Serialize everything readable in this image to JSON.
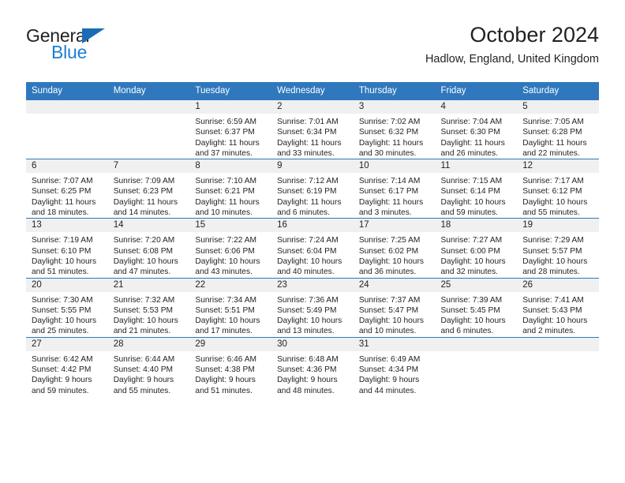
{
  "brand": {
    "name_part1": "General",
    "name_part2": "Blue",
    "accent_color": "#1b7fd4",
    "triangle_color": "#1b6cb5"
  },
  "header": {
    "title": "October 2024",
    "location": "Hadlow, England, United Kingdom",
    "header_bg_color": "#2f78bd",
    "header_text_color": "#ffffff"
  },
  "weekdays": [
    "Sunday",
    "Monday",
    "Tuesday",
    "Wednesday",
    "Thursday",
    "Friday",
    "Saturday"
  ],
  "labels": {
    "sunrise_prefix": "Sunrise:",
    "sunset_prefix": "Sunset:",
    "daylight_prefix": "Daylight:"
  },
  "weeks": [
    [
      {
        "day": "",
        "blank": true
      },
      {
        "day": "",
        "blank": true
      },
      {
        "day": "1",
        "sunrise": "Sunrise: 6:59 AM",
        "sunset": "Sunset: 6:37 PM",
        "daylight_line1": "Daylight: 11 hours",
        "daylight_line2": "and 37 minutes."
      },
      {
        "day": "2",
        "sunrise": "Sunrise: 7:01 AM",
        "sunset": "Sunset: 6:34 PM",
        "daylight_line1": "Daylight: 11 hours",
        "daylight_line2": "and 33 minutes."
      },
      {
        "day": "3",
        "sunrise": "Sunrise: 7:02 AM",
        "sunset": "Sunset: 6:32 PM",
        "daylight_line1": "Daylight: 11 hours",
        "daylight_line2": "and 30 minutes."
      },
      {
        "day": "4",
        "sunrise": "Sunrise: 7:04 AM",
        "sunset": "Sunset: 6:30 PM",
        "daylight_line1": "Daylight: 11 hours",
        "daylight_line2": "and 26 minutes."
      },
      {
        "day": "5",
        "sunrise": "Sunrise: 7:05 AM",
        "sunset": "Sunset: 6:28 PM",
        "daylight_line1": "Daylight: 11 hours",
        "daylight_line2": "and 22 minutes."
      }
    ],
    [
      {
        "day": "6",
        "sunrise": "Sunrise: 7:07 AM",
        "sunset": "Sunset: 6:25 PM",
        "daylight_line1": "Daylight: 11 hours",
        "daylight_line2": "and 18 minutes."
      },
      {
        "day": "7",
        "sunrise": "Sunrise: 7:09 AM",
        "sunset": "Sunset: 6:23 PM",
        "daylight_line1": "Daylight: 11 hours",
        "daylight_line2": "and 14 minutes."
      },
      {
        "day": "8",
        "sunrise": "Sunrise: 7:10 AM",
        "sunset": "Sunset: 6:21 PM",
        "daylight_line1": "Daylight: 11 hours",
        "daylight_line2": "and 10 minutes."
      },
      {
        "day": "9",
        "sunrise": "Sunrise: 7:12 AM",
        "sunset": "Sunset: 6:19 PM",
        "daylight_line1": "Daylight: 11 hours",
        "daylight_line2": "and 6 minutes."
      },
      {
        "day": "10",
        "sunrise": "Sunrise: 7:14 AM",
        "sunset": "Sunset: 6:17 PM",
        "daylight_line1": "Daylight: 11 hours",
        "daylight_line2": "and 3 minutes."
      },
      {
        "day": "11",
        "sunrise": "Sunrise: 7:15 AM",
        "sunset": "Sunset: 6:14 PM",
        "daylight_line1": "Daylight: 10 hours",
        "daylight_line2": "and 59 minutes."
      },
      {
        "day": "12",
        "sunrise": "Sunrise: 7:17 AM",
        "sunset": "Sunset: 6:12 PM",
        "daylight_line1": "Daylight: 10 hours",
        "daylight_line2": "and 55 minutes."
      }
    ],
    [
      {
        "day": "13",
        "sunrise": "Sunrise: 7:19 AM",
        "sunset": "Sunset: 6:10 PM",
        "daylight_line1": "Daylight: 10 hours",
        "daylight_line2": "and 51 minutes."
      },
      {
        "day": "14",
        "sunrise": "Sunrise: 7:20 AM",
        "sunset": "Sunset: 6:08 PM",
        "daylight_line1": "Daylight: 10 hours",
        "daylight_line2": "and 47 minutes."
      },
      {
        "day": "15",
        "sunrise": "Sunrise: 7:22 AM",
        "sunset": "Sunset: 6:06 PM",
        "daylight_line1": "Daylight: 10 hours",
        "daylight_line2": "and 43 minutes."
      },
      {
        "day": "16",
        "sunrise": "Sunrise: 7:24 AM",
        "sunset": "Sunset: 6:04 PM",
        "daylight_line1": "Daylight: 10 hours",
        "daylight_line2": "and 40 minutes."
      },
      {
        "day": "17",
        "sunrise": "Sunrise: 7:25 AM",
        "sunset": "Sunset: 6:02 PM",
        "daylight_line1": "Daylight: 10 hours",
        "daylight_line2": "and 36 minutes."
      },
      {
        "day": "18",
        "sunrise": "Sunrise: 7:27 AM",
        "sunset": "Sunset: 6:00 PM",
        "daylight_line1": "Daylight: 10 hours",
        "daylight_line2": "and 32 minutes."
      },
      {
        "day": "19",
        "sunrise": "Sunrise: 7:29 AM",
        "sunset": "Sunset: 5:57 PM",
        "daylight_line1": "Daylight: 10 hours",
        "daylight_line2": "and 28 minutes."
      }
    ],
    [
      {
        "day": "20",
        "sunrise": "Sunrise: 7:30 AM",
        "sunset": "Sunset: 5:55 PM",
        "daylight_line1": "Daylight: 10 hours",
        "daylight_line2": "and 25 minutes."
      },
      {
        "day": "21",
        "sunrise": "Sunrise: 7:32 AM",
        "sunset": "Sunset: 5:53 PM",
        "daylight_line1": "Daylight: 10 hours",
        "daylight_line2": "and 21 minutes."
      },
      {
        "day": "22",
        "sunrise": "Sunrise: 7:34 AM",
        "sunset": "Sunset: 5:51 PM",
        "daylight_line1": "Daylight: 10 hours",
        "daylight_line2": "and 17 minutes."
      },
      {
        "day": "23",
        "sunrise": "Sunrise: 7:36 AM",
        "sunset": "Sunset: 5:49 PM",
        "daylight_line1": "Daylight: 10 hours",
        "daylight_line2": "and 13 minutes."
      },
      {
        "day": "24",
        "sunrise": "Sunrise: 7:37 AM",
        "sunset": "Sunset: 5:47 PM",
        "daylight_line1": "Daylight: 10 hours",
        "daylight_line2": "and 10 minutes."
      },
      {
        "day": "25",
        "sunrise": "Sunrise: 7:39 AM",
        "sunset": "Sunset: 5:45 PM",
        "daylight_line1": "Daylight: 10 hours",
        "daylight_line2": "and 6 minutes."
      },
      {
        "day": "26",
        "sunrise": "Sunrise: 7:41 AM",
        "sunset": "Sunset: 5:43 PM",
        "daylight_line1": "Daylight: 10 hours",
        "daylight_line2": "and 2 minutes."
      }
    ],
    [
      {
        "day": "27",
        "sunrise": "Sunrise: 6:42 AM",
        "sunset": "Sunset: 4:42 PM",
        "daylight_line1": "Daylight: 9 hours",
        "daylight_line2": "and 59 minutes."
      },
      {
        "day": "28",
        "sunrise": "Sunrise: 6:44 AM",
        "sunset": "Sunset: 4:40 PM",
        "daylight_line1": "Daylight: 9 hours",
        "daylight_line2": "and 55 minutes."
      },
      {
        "day": "29",
        "sunrise": "Sunrise: 6:46 AM",
        "sunset": "Sunset: 4:38 PM",
        "daylight_line1": "Daylight: 9 hours",
        "daylight_line2": "and 51 minutes."
      },
      {
        "day": "30",
        "sunrise": "Sunrise: 6:48 AM",
        "sunset": "Sunset: 4:36 PM",
        "daylight_line1": "Daylight: 9 hours",
        "daylight_line2": "and 48 minutes."
      },
      {
        "day": "31",
        "sunrise": "Sunrise: 6:49 AM",
        "sunset": "Sunset: 4:34 PM",
        "daylight_line1": "Daylight: 9 hours",
        "daylight_line2": "and 44 minutes."
      },
      {
        "day": "",
        "blank": true
      },
      {
        "day": "",
        "blank": true
      }
    ]
  ]
}
